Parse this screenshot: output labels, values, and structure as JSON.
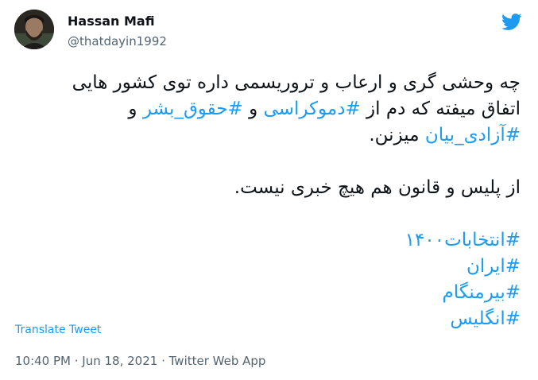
{
  "author": {
    "name": "Hassan Mafi",
    "handle": "@thatdayin1992"
  },
  "tweet": {
    "line1": "چه وحشی گری و ارعاب و تروریسمی داره توی کشور هایی",
    "line2_text1": "اتفاق میفته که دم از ",
    "line2_tag1": "#دموکراسی",
    "line2_text2": " و ",
    "line2_tag2": "#حقوق_بشر",
    "line2_text3": " و",
    "line3_tag": "#آزادی_بیان",
    "line3_text": " میزنن.",
    "line4": "از پلیس و قانون هم هیچ خبری نیست.",
    "hashtags": [
      "#انتخابات۱۴۰۰",
      "#ایران",
      "#بیرمنگام",
      "#انگلیس"
    ]
  },
  "translate_label": "Translate Tweet",
  "meta": {
    "time": "10:40 PM",
    "separator1": " · ",
    "date": "Jun 18, 2021",
    "separator2": " · ",
    "source": "Twitter Web App"
  },
  "colors": {
    "link": "#1d9bf0",
    "secondary_text": "#536471",
    "primary_text": "#0f1419"
  },
  "icons": {
    "logo": "twitter-bird-icon"
  }
}
